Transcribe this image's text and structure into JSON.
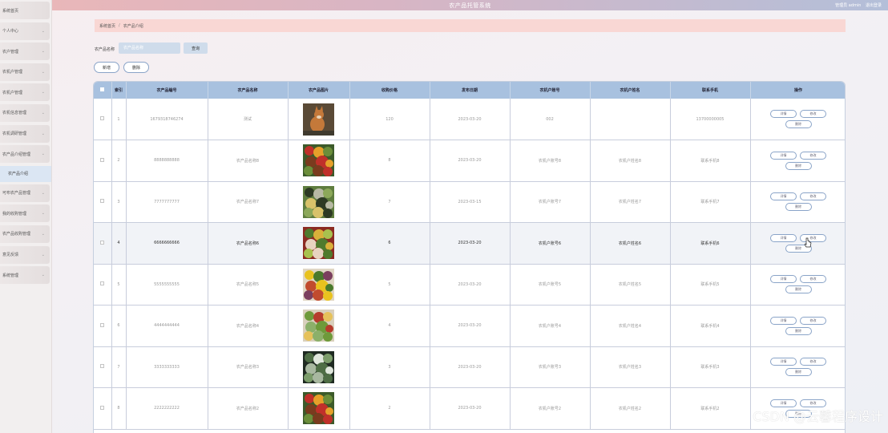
{
  "header": {
    "title": "农产品托管系统",
    "user_label": "管理员 admin",
    "logout_label": "退出登录"
  },
  "sidebar": {
    "items": [
      {
        "label": "系统首页",
        "chevron": false
      },
      {
        "label": "个人中心",
        "chevron": true
      },
      {
        "label": "农户管理",
        "chevron": true
      },
      {
        "label": "农机户管理",
        "chevron": true
      },
      {
        "label": "农机户管理",
        "chevron": true
      },
      {
        "label": "农机信息管理",
        "chevron": true
      },
      {
        "label": "农机调研管理",
        "chevron": true
      },
      {
        "label": "农产品介绍管理",
        "chevron": true
      }
    ],
    "active_sub": "农产品介绍",
    "items_after": [
      {
        "label": "可布农产品管理",
        "chevron": true
      },
      {
        "label": "我的收购管理",
        "chevron": true
      },
      {
        "label": "农产品收购管理",
        "chevron": true
      },
      {
        "label": "意见反馈",
        "chevron": true
      },
      {
        "label": "系统管理",
        "chevron": true
      }
    ]
  },
  "breadcrumb": {
    "home": "系统首页",
    "separator": "/",
    "current": "农产品介绍"
  },
  "search": {
    "label": "农产品名称",
    "placeholder": "农产品名称",
    "query_button": "查询"
  },
  "actions": {
    "add": "新增",
    "delete": "删除"
  },
  "table": {
    "headers": [
      "索引",
      "农产品编号",
      "农产品名称",
      "农产品图片",
      "收购价格",
      "发布日期",
      "农机户账号",
      "农机户姓名",
      "联系手机",
      "操作"
    ],
    "rows": [
      {
        "index": "1",
        "code": "1679318746274",
        "name": "测试",
        "price": "120",
        "date": "2023-03-20",
        "account": "002",
        "owner": "",
        "phone": "13700000005",
        "img": "fox"
      },
      {
        "index": "2",
        "code": "8888888888",
        "name": "农产品名称8",
        "price": "8",
        "date": "2023-03-20",
        "account": "农机户账号8",
        "owner": "农机户姓名8",
        "phone": "联系手机8",
        "img": "veg1"
      },
      {
        "index": "3",
        "code": "7777777777",
        "name": "农产品名称7",
        "price": "7",
        "date": "2023-03-15",
        "account": "农机户账号7",
        "owner": "农机户姓名7",
        "phone": "联系手机7",
        "img": "veg2"
      },
      {
        "index": "4",
        "code": "6666666666",
        "name": "农产品名称6",
        "price": "6",
        "date": "2023-03-20",
        "account": "农机户账号6",
        "owner": "农机户姓名6",
        "phone": "联系手机6",
        "img": "veg3"
      },
      {
        "index": "5",
        "code": "5555555555",
        "name": "农产品名称5",
        "price": "5",
        "date": "2023-03-20",
        "account": "农机户账号5",
        "owner": "农机户姓名5",
        "phone": "联系手机5",
        "img": "veg4"
      },
      {
        "index": "6",
        "code": "4444444444",
        "name": "农产品名称4",
        "price": "4",
        "date": "2023-03-20",
        "account": "农机户账号4",
        "owner": "农机户姓名4",
        "phone": "联系手机4",
        "img": "veg5"
      },
      {
        "index": "7",
        "code": "3333333333",
        "name": "农产品名称3",
        "price": "3",
        "date": "2023-03-20",
        "account": "农机户账号3",
        "owner": "农机户姓名3",
        "phone": "联系手机3",
        "img": "veg6"
      },
      {
        "index": "8",
        "code": "2222222222",
        "name": "农产品名称2",
        "price": "2",
        "date": "2023-03-20",
        "account": "农机户账号2",
        "owner": "农机户姓名2",
        "phone": "联系手机2",
        "img": "veg1"
      }
    ],
    "active_row": 3,
    "row_actions": {
      "detail": "详情",
      "edit": "修改",
      "delete": "删除"
    }
  },
  "watermark": "CSDN @云馨程序设计",
  "colors": {
    "header_start": "#e9b7b9",
    "header_end": "#b3bfd9",
    "table_header": "#a8c1df",
    "button_border": "#8aa4c8",
    "breadcrumb_bg": "#f9d7d4"
  }
}
